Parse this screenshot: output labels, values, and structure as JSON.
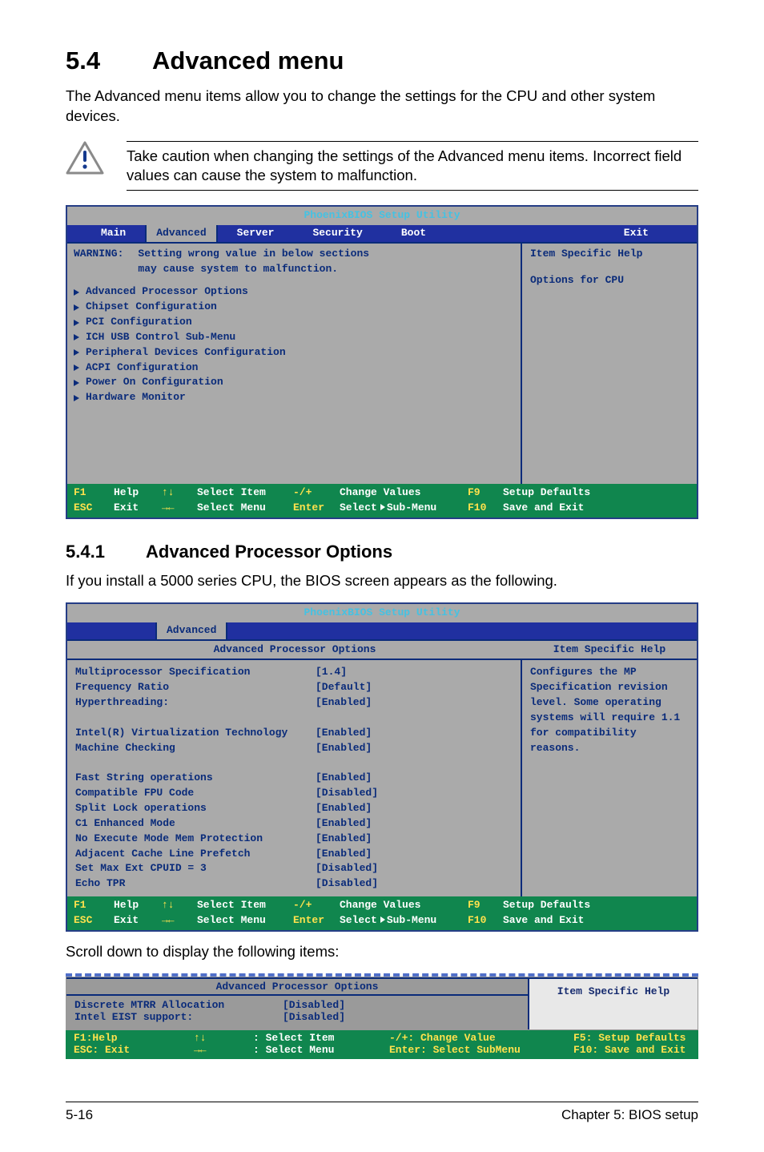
{
  "heading": {
    "number": "5.4",
    "title": "Advanced menu"
  },
  "intro": "The Advanced menu items allow you to change the settings for the CPU and other system devices.",
  "caution": "Take caution when changing the settings of the Advanced menu items. Incorrect field values can cause the system to malfunction.",
  "bios1": {
    "title": "PhoenixBIOS Setup Utility",
    "tabs": {
      "main": "Main",
      "advanced": "Advanced",
      "server": "Server",
      "security": "Security",
      "boot": "Boot",
      "exit": "Exit"
    },
    "warning_label": "WARNING:",
    "warning_text1": "Setting wrong value in below sections",
    "warning_text2": "may cause system to malfunction.",
    "items": [
      "Advanced Processor Options",
      "Chipset Configuration",
      "PCI Configuration",
      "ICH USB Control Sub-Menu",
      "Peripheral Devices Configuration",
      "ACPI Configuration",
      "Power On Configuration",
      "Hardware Monitor"
    ],
    "help_title": "Item Specific Help",
    "help_body": "Options for CPU",
    "footer": {
      "f1": "F1",
      "help": "Help",
      "arrows": "↑↓",
      "selitem": "Select Item",
      "pm": "-/+",
      "chval": "Change Values",
      "f9": "F9",
      "setdef": "Setup Defaults",
      "esc": "ESC",
      "exit": "Exit",
      "lr": "→←",
      "selmenu": "Select Menu",
      "enter": "Enter",
      "selsub": "Select",
      "subm": "Sub-Menu",
      "f10": "F10",
      "save": "Save and Exit"
    }
  },
  "subheading": {
    "number": "5.4.1",
    "title": "Advanced Processor Options"
  },
  "subintro": "If you install a 5000 series CPU, the BIOS screen appears as the following.",
  "bios2": {
    "title": "PhoenixBIOS Setup Utility",
    "tab": "Advanced",
    "panel_title": "Advanced Processor Options",
    "settings": [
      {
        "k": "Multiprocessor Specification",
        "v": "[1.4]"
      },
      {
        "k": "Frequency Ratio",
        "v": "[Default]"
      },
      {
        "k": "Hyperthreading:",
        "v": "[Enabled]"
      },
      {
        "k": "",
        "v": ""
      },
      {
        "k": "Intel(R) Virtualization Technology",
        "v": "[Enabled]"
      },
      {
        "k": "Machine Checking",
        "v": "[Enabled]"
      },
      {
        "k": "",
        "v": ""
      },
      {
        "k": "Fast String operations",
        "v": "[Enabled]"
      },
      {
        "k": "Compatible FPU Code",
        "v": "[Disabled]"
      },
      {
        "k": "Split Lock operations",
        "v": "[Enabled]"
      },
      {
        "k": "C1 Enhanced Mode",
        "v": "[Enabled]"
      },
      {
        "k": "No Execute Mode Mem Protection",
        "v": "[Enabled]"
      },
      {
        "k": "Adjacent Cache Line Prefetch",
        "v": "[Enabled]"
      },
      {
        "k": "Set Max Ext CPUID = 3",
        "v": "[Disabled]"
      },
      {
        "k": "Echo TPR",
        "v": "[Disabled]"
      }
    ],
    "help_title": "Item Specific Help",
    "help_body": "Configures the MP Specification revision level. Some operating systems will require 1.1 for compatibility reasons."
  },
  "scroll_intro": "Scroll down to display the following items:",
  "bios3": {
    "panel_title": "Advanced Processor Options",
    "help_title": "Item Specific Help",
    "settings": [
      {
        "k": "Discrete MTRR Allocation",
        "v": "[Disabled]"
      },
      {
        "k": "Intel EIST support:",
        "v": "[Disabled]"
      }
    ],
    "footer": {
      "f1help": "F1:Help",
      "arrows": "↑↓",
      "selitem": ": Select Item",
      "pm": "-/+: Change Value",
      "f5": "F5: Setup Defaults",
      "escexit": "ESC: Exit",
      "lr": "→←",
      "selmenu": ": Select Menu",
      "enter": "Enter: Select SubMenu",
      "f10": "F10: Save and Exit"
    }
  },
  "footer": {
    "left": "5-16",
    "right": "Chapter 5: BIOS setup"
  }
}
